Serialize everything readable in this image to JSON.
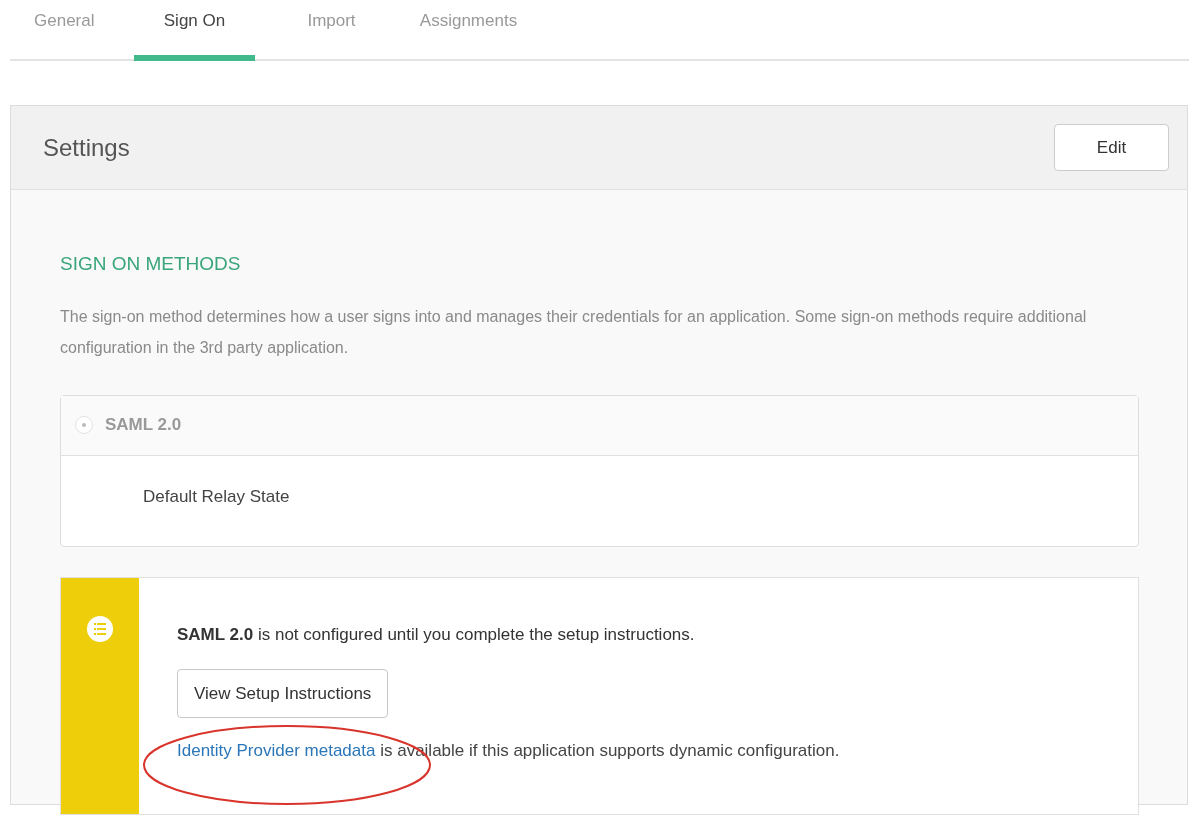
{
  "tabs": [
    {
      "label": "General",
      "selected": false
    },
    {
      "label": "Sign On",
      "selected": true
    },
    {
      "label": "Import",
      "selected": false
    },
    {
      "label": "Assignments",
      "selected": false
    }
  ],
  "panel": {
    "title": "Settings",
    "edit_button": "Edit"
  },
  "section": {
    "heading": "SIGN ON METHODS",
    "description": "The sign-on method determines how a user signs into and manages their credentials for an application. Some sign-on methods require additional configuration in the 3rd party application."
  },
  "methods": [
    {
      "label": "SAML 2.0",
      "selected": true,
      "field_label": "Default Relay State"
    }
  ],
  "notice": {
    "message": "**SAML 2.0** is not configured until you complete the setup instructions.",
    "button": "View Setup Instructions",
    "link": "Identity Provider metadata",
    "link_suffix": " is available if this application supports dynamic configuration.",
    "annotation": {
      "kind": "ellipse",
      "color": "#d9342b"
    }
  }
}
